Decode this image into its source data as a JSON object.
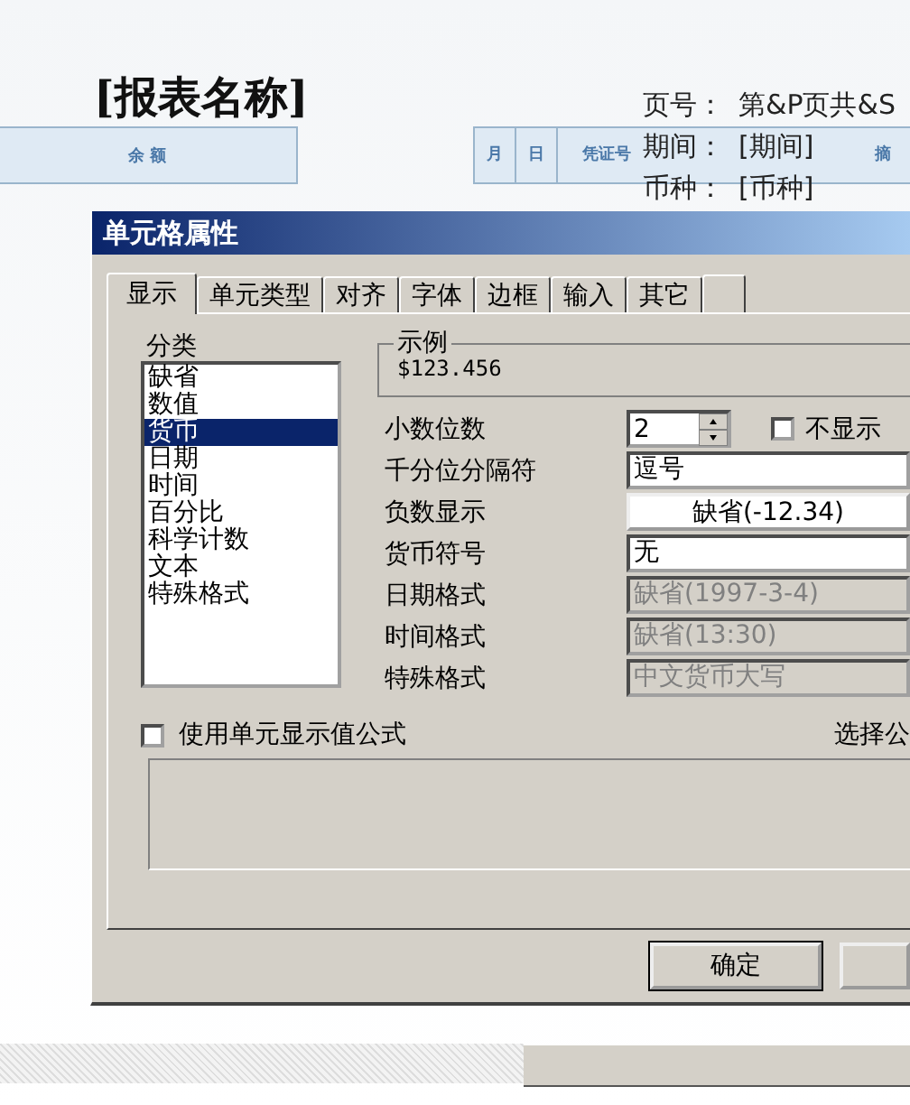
{
  "report": {
    "title": "[报表名称]",
    "info": [
      {
        "label": "页号：",
        "value": "第&P页共&S"
      },
      {
        "label": "期间：",
        "value": "[期间]"
      },
      {
        "label": "币种：",
        "value": "[币种]"
      }
    ],
    "left_headers": [
      "余 额"
    ],
    "right_headers": [
      "月",
      "日",
      "凭证号",
      "摘"
    ]
  },
  "dialog": {
    "title": "单元格属性",
    "tabs": [
      {
        "label": "显示",
        "selected": true
      },
      {
        "label": "单元类型",
        "selected": false
      },
      {
        "label": "对齐",
        "selected": false
      },
      {
        "label": "字体",
        "selected": false
      },
      {
        "label": "边框",
        "selected": false
      },
      {
        "label": "输入",
        "selected": false
      },
      {
        "label": "其它",
        "selected": false
      }
    ],
    "category_label": "分类",
    "categories": [
      {
        "label": "缺省",
        "selected": false
      },
      {
        "label": "数值",
        "selected": false
      },
      {
        "label": "货币",
        "selected": true
      },
      {
        "label": "日期",
        "selected": false
      },
      {
        "label": "时间",
        "selected": false
      },
      {
        "label": "百分比",
        "selected": false
      },
      {
        "label": "科学计数",
        "selected": false
      },
      {
        "label": "文本",
        "selected": false
      },
      {
        "label": "特殊格式",
        "selected": false
      }
    ],
    "sample": {
      "label": "示例",
      "value": "$123.456"
    },
    "fields": [
      {
        "kind": "spinner",
        "label": "小数位数",
        "value": "2",
        "checkbox": {
          "label": "不显示",
          "checked": false
        }
      },
      {
        "kind": "select",
        "label": "千分位分隔符",
        "value": "逗号",
        "disabled": false
      },
      {
        "kind": "button",
        "label": "负数显示",
        "value": "缺省(-12.34)"
      },
      {
        "kind": "select",
        "label": "货币符号",
        "value": "无",
        "disabled": false
      },
      {
        "kind": "select",
        "label": "日期格式",
        "value": "缺省(1997-3-4)",
        "disabled": true
      },
      {
        "kind": "select",
        "label": "时间格式",
        "value": "缺省(13:30)",
        "disabled": true
      },
      {
        "kind": "select",
        "label": "特殊格式",
        "value": "中文货币大写",
        "disabled": true
      }
    ],
    "formula_checkbox": {
      "label": "使用单元显示值公式",
      "checked": false
    },
    "formula_link": "选择公",
    "buttons": [
      "确定"
    ]
  }
}
